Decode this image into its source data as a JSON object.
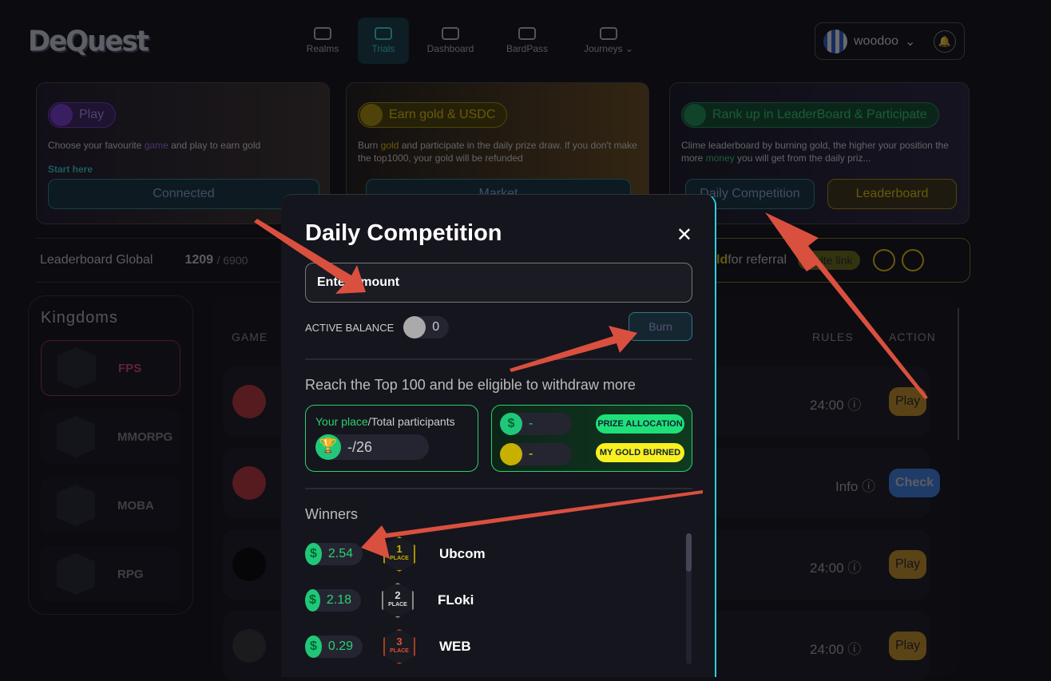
{
  "header": {
    "logo": "DeQuest",
    "nav": [
      {
        "label": "Realms",
        "icon": "gamepad-icon"
      },
      {
        "label": "Trials",
        "icon": "swords-icon",
        "active": true
      },
      {
        "label": "Dashboard",
        "icon": "dashboard-icon"
      },
      {
        "label": "BardPass",
        "icon": "pass-icon"
      },
      {
        "label": "Journeys",
        "icon": "journeys-icon"
      }
    ],
    "user": "woodoo"
  },
  "cards": [
    {
      "pill": "Play",
      "text_pre": "Choose your favourite ",
      "text_hl": "game",
      "text_post": " and play to earn gold",
      "link": "Start here",
      "button": "Connected"
    },
    {
      "pill": "Earn gold & USDC",
      "text_pre": "Burn ",
      "text_hl": "gold",
      "text_post": " and participate in the daily prize draw. If you don't make the top1000, your gold will be refunded",
      "button": "Market"
    },
    {
      "pill": "Rank up in LeaderBoard & Participate",
      "text_pre": "Clime leaderboard by burning gold, the higher your position the more ",
      "text_hl": "money",
      "text_post": " you will get from the daily priz...",
      "button": "Daily Competition",
      "button2": "Leaderboard"
    }
  ],
  "leaderboard": {
    "label": "Leaderboard Global",
    "rank": "1209",
    "total": "/ 6900"
  },
  "referral": {
    "text_hl": "ld",
    "text": " for referral",
    "invite": "Invite link"
  },
  "kingdoms": {
    "title": "Kingdoms",
    "items": [
      "FPS",
      "MMORPG",
      "MOBA",
      "RPG"
    ]
  },
  "table": {
    "headers": {
      "game": "GAME",
      "rules": "RULES",
      "action": "ACTION"
    },
    "rows": [
      {
        "rule": "24:00",
        "action": "Play"
      },
      {
        "rule": "Info",
        "action": "Check"
      },
      {
        "rule": "24:00",
        "action": "Play"
      },
      {
        "rule": "24:00",
        "action": "Play"
      }
    ]
  },
  "modal": {
    "title": "Daily Competition",
    "placeholder": "Enter amount",
    "balance_label": "ACTIVE BALANCE",
    "balance": "0",
    "burn": "Burn",
    "reach": "Reach the Top 100 and be eligible to withdraw more",
    "place_hl": "Your place",
    "place_rest": "/Total participants",
    "place_value": "-/26",
    "prize_value": "-",
    "burned_value": "-",
    "prize_label": "PRIZE ALLOCATION",
    "burned_label": "MY GOLD BURNED",
    "winners_title": "Winners",
    "winners": [
      {
        "amount": "2.54",
        "place": "1",
        "place_label": "PLACE",
        "name": "Ubcom"
      },
      {
        "amount": "2.18",
        "place": "2",
        "place_label": "PLACE",
        "name": "FLoki"
      },
      {
        "amount": "0.29",
        "place": "3",
        "place_label": "PLACE",
        "name": "WEB"
      }
    ]
  },
  "colors": {
    "accent": "#2ad0e0",
    "green": "#1fc878",
    "gold": "#e8c400",
    "annotation": "#d9503f"
  }
}
